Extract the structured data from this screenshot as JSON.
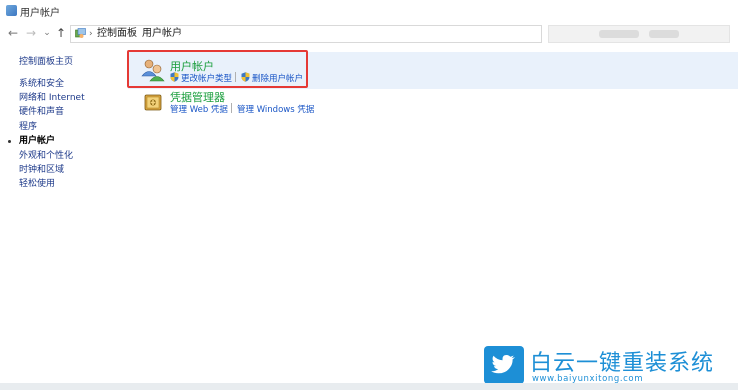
{
  "window": {
    "title": "用户帐户"
  },
  "nav_buttons": {
    "back": "←",
    "forward": "→",
    "dropdown": "⌄",
    "up": "↑"
  },
  "breadcrumb": {
    "items": [
      "控制面板",
      "用户帐户"
    ],
    "separator": "›"
  },
  "sidebar": {
    "items": [
      {
        "label": "控制面板主页",
        "current": false
      },
      {
        "label": "系统和安全",
        "current": false
      },
      {
        "label": "网络和 Internet",
        "current": false
      },
      {
        "label": "硬件和声音",
        "current": false
      },
      {
        "label": "程序",
        "current": false
      },
      {
        "label": "用户帐户",
        "current": true
      },
      {
        "label": "外观和个性化",
        "current": false
      },
      {
        "label": "时钟和区域",
        "current": false
      },
      {
        "label": "轻松使用",
        "current": false
      }
    ]
  },
  "categories": [
    {
      "title": "用户帐户",
      "links": [
        "更改帐户类型",
        "删除用户帐户"
      ],
      "icon": "user-accounts-icon",
      "highlighted": true
    },
    {
      "title": "凭据管理器",
      "links": [
        "管理 Web 凭据",
        "管理 Windows 凭据"
      ],
      "icon": "credential-manager-icon",
      "highlighted": false
    }
  ],
  "watermark": {
    "text": "白云一键重装系统",
    "url": "www.baiyunxitong.com",
    "icon": "twitter-bird-icon"
  },
  "colors": {
    "category_title": "#1a9e3c",
    "link": "#1a56c6",
    "highlight_bg": "#e9f1fb",
    "annotation_box": "#e53935",
    "watermark": "#1d8fd6"
  }
}
